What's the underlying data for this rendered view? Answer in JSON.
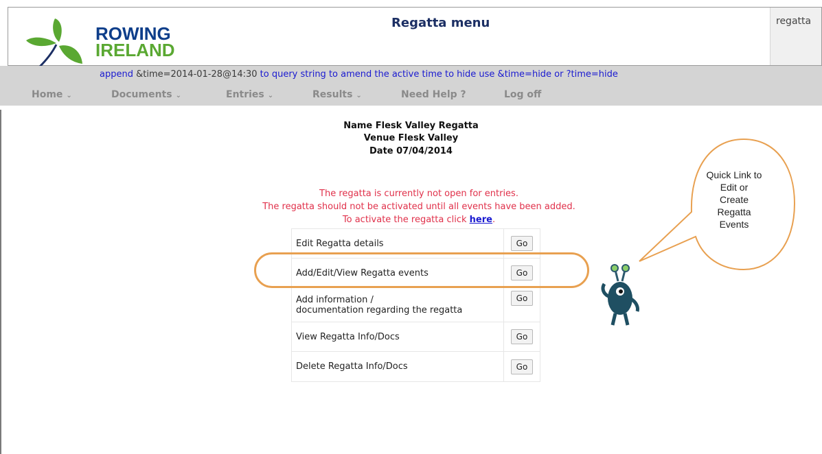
{
  "header": {
    "logo_line1": "ROWING",
    "logo_line2": "IRELAND",
    "menu_title": "Regatta menu",
    "user_text": "regatta"
  },
  "time_note": {
    "prefix": "append ",
    "value": "&time=2014-01-28@14:30",
    "suffix": " to query string to amend the active time to hide use &time=hide or ?time=hide"
  },
  "nav": {
    "items": [
      {
        "label": "Home",
        "caret": "⌄"
      },
      {
        "label": "Documents",
        "caret": "⌄"
      },
      {
        "label": "Entries",
        "caret": "⌄"
      },
      {
        "label": "Results",
        "caret": "⌄"
      },
      {
        "label": "Need Help ?"
      },
      {
        "label": "Log off"
      }
    ]
  },
  "regatta": {
    "name": "Name Flesk Valley Regatta",
    "venue": "Venue Flesk Valley",
    "date": "Date 07/04/2014"
  },
  "warning": {
    "line1": "The regatta is currently not open for entries.",
    "line2": "The regatta should not be activated until all events have been added.",
    "line3_prefix": "To activate the regatta click ",
    "link": "here",
    "line3_suffix": "."
  },
  "actions": [
    {
      "label": "Edit Regatta details",
      "button": "Go"
    },
    {
      "label": "Add/Edit/View Regatta events",
      "button": "Go"
    },
    {
      "label_line1": "Add information /",
      "label_line2": "documentation regarding the regatta",
      "button": "Go"
    },
    {
      "label": "View Regatta Info/Docs",
      "button": "Go"
    },
    {
      "label": "Delete Regatta Info/Docs",
      "button": "Go"
    }
  ],
  "callout": {
    "line1": "Quick Link to",
    "line2": "Edit or",
    "line3": "Create",
    "line4": "Regatta",
    "line5": "Events"
  },
  "colors": {
    "accent_orange": "#e8a050",
    "warning_red": "#e0304a",
    "link_blue": "#1a1ad0",
    "brand_blue": "#0e3e8a",
    "brand_green": "#5aa832"
  }
}
